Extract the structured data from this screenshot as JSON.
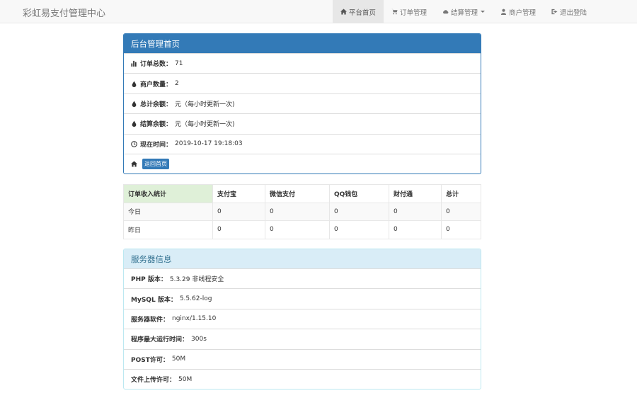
{
  "brand": "彩虹易支付管理中心",
  "nav": [
    {
      "label": "平台首页",
      "icon": "home-icon",
      "active": true
    },
    {
      "label": "订单管理",
      "icon": "cart-icon"
    },
    {
      "label": "结算管理",
      "icon": "cloud-icon",
      "dropdown": true
    },
    {
      "label": "商户管理",
      "icon": "user-icon"
    },
    {
      "label": "退出登陆",
      "icon": "logout-icon"
    }
  ],
  "overview": {
    "title": "后台管理首页",
    "order_total": {
      "label": "订单总数：",
      "value": "71"
    },
    "merchant_count": {
      "label": "商户数量：",
      "value": "2"
    },
    "total_balance": {
      "label": "总计余额：",
      "value": "元（每小时更新一次)"
    },
    "settle_balance": {
      "label": "结算余额：",
      "value": "元（每小时更新一次)"
    },
    "current_time": {
      "label": "现在时间：",
      "value": "2019-10-17 19:18:03"
    },
    "home_button": "返回首页"
  },
  "stats": {
    "headers": [
      "订单收入统计",
      "支付宝",
      "微信支付",
      "QQ钱包",
      "财付通",
      "总计"
    ],
    "rows": [
      [
        "今日",
        "0",
        "0",
        "0",
        "0",
        "0"
      ],
      [
        "昨日",
        "0",
        "0",
        "0",
        "0",
        "0"
      ]
    ]
  },
  "server": {
    "title": "服务器信息",
    "php": {
      "label": "PHP 版本：",
      "value": "5.3.29 非线程安全"
    },
    "mysql": {
      "label": "MySQL 版本：",
      "value": "5.5.62-log"
    },
    "software": {
      "label": "服务器软件：",
      "value": "nginx/1.15.10"
    },
    "max_exec": {
      "label": "程序最大运行时间：",
      "value": "300s"
    },
    "post": {
      "label": "POST许可：",
      "value": "50M"
    },
    "upload": {
      "label": "文件上传许可：",
      "value": "50M"
    }
  },
  "colors": {
    "primary": "#337ab7",
    "info_bg": "#d9edf7",
    "info_text": "#31708f",
    "success_bg": "#dff0d8"
  }
}
